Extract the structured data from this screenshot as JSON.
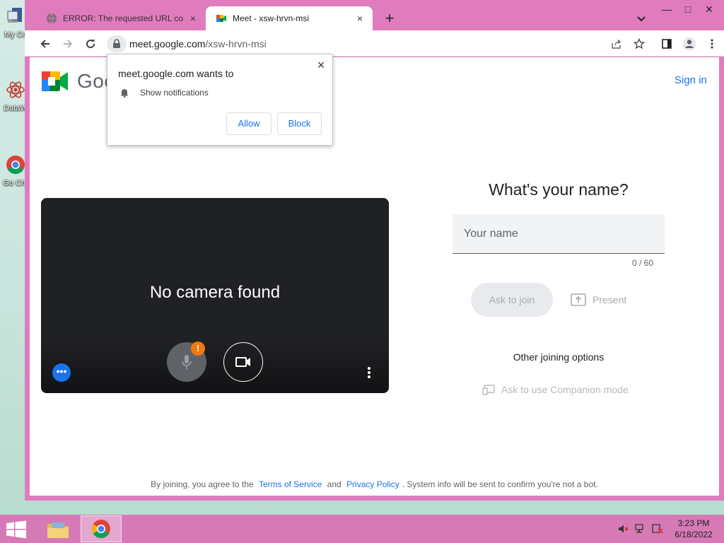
{
  "desktop": {
    "icons": [
      {
        "label": "My Co"
      },
      {
        "label": "DataW"
      },
      {
        "label": "Go Chr"
      }
    ]
  },
  "tabs": [
    {
      "title": "ERROR: The requested URL could",
      "close": "×"
    },
    {
      "title": "Meet - xsw-hrvn-msi",
      "close": "×"
    }
  ],
  "tabstrip": {
    "new_tab": "+",
    "tab_search": "chevron-down-icon"
  },
  "window_controls": {
    "minimize": "—",
    "maximize": "□",
    "close": "✕"
  },
  "omnibox": {
    "host": "meet.google.com",
    "path": "/xsw-hrvn-msi"
  },
  "meet": {
    "logo_text": "Goo",
    "sign_in": "Sign in",
    "preview": {
      "message": "No camera found",
      "mic_badge": "!",
      "effects": "•••"
    },
    "join": {
      "title": "What's your name?",
      "name_placeholder": "Your name",
      "name_value": "",
      "char_count": "0 / 60",
      "ask_to_join": "Ask to join",
      "present": "Present",
      "other_options": "Other joining options",
      "companion": "Ask to use Companion mode"
    },
    "legal": {
      "prefix": "By joining, you agree to the",
      "terms": "Terms of Service",
      "and": "and",
      "privacy": "Privacy Policy",
      "suffix": ". System info will be sent to confirm you're not a bot."
    }
  },
  "permission_popup": {
    "title": "meet.google.com wants to",
    "permission": "Show notifications",
    "allow": "Allow",
    "block": "Block",
    "close": "×"
  },
  "taskbar": {
    "time": "3:23 PM",
    "date": "6/18/2022"
  },
  "colors": {
    "accent": "#1a73e8",
    "window_frame": "#e07cbe",
    "taskbar": "#d67ab6",
    "mic_badge": "#f4780b"
  }
}
